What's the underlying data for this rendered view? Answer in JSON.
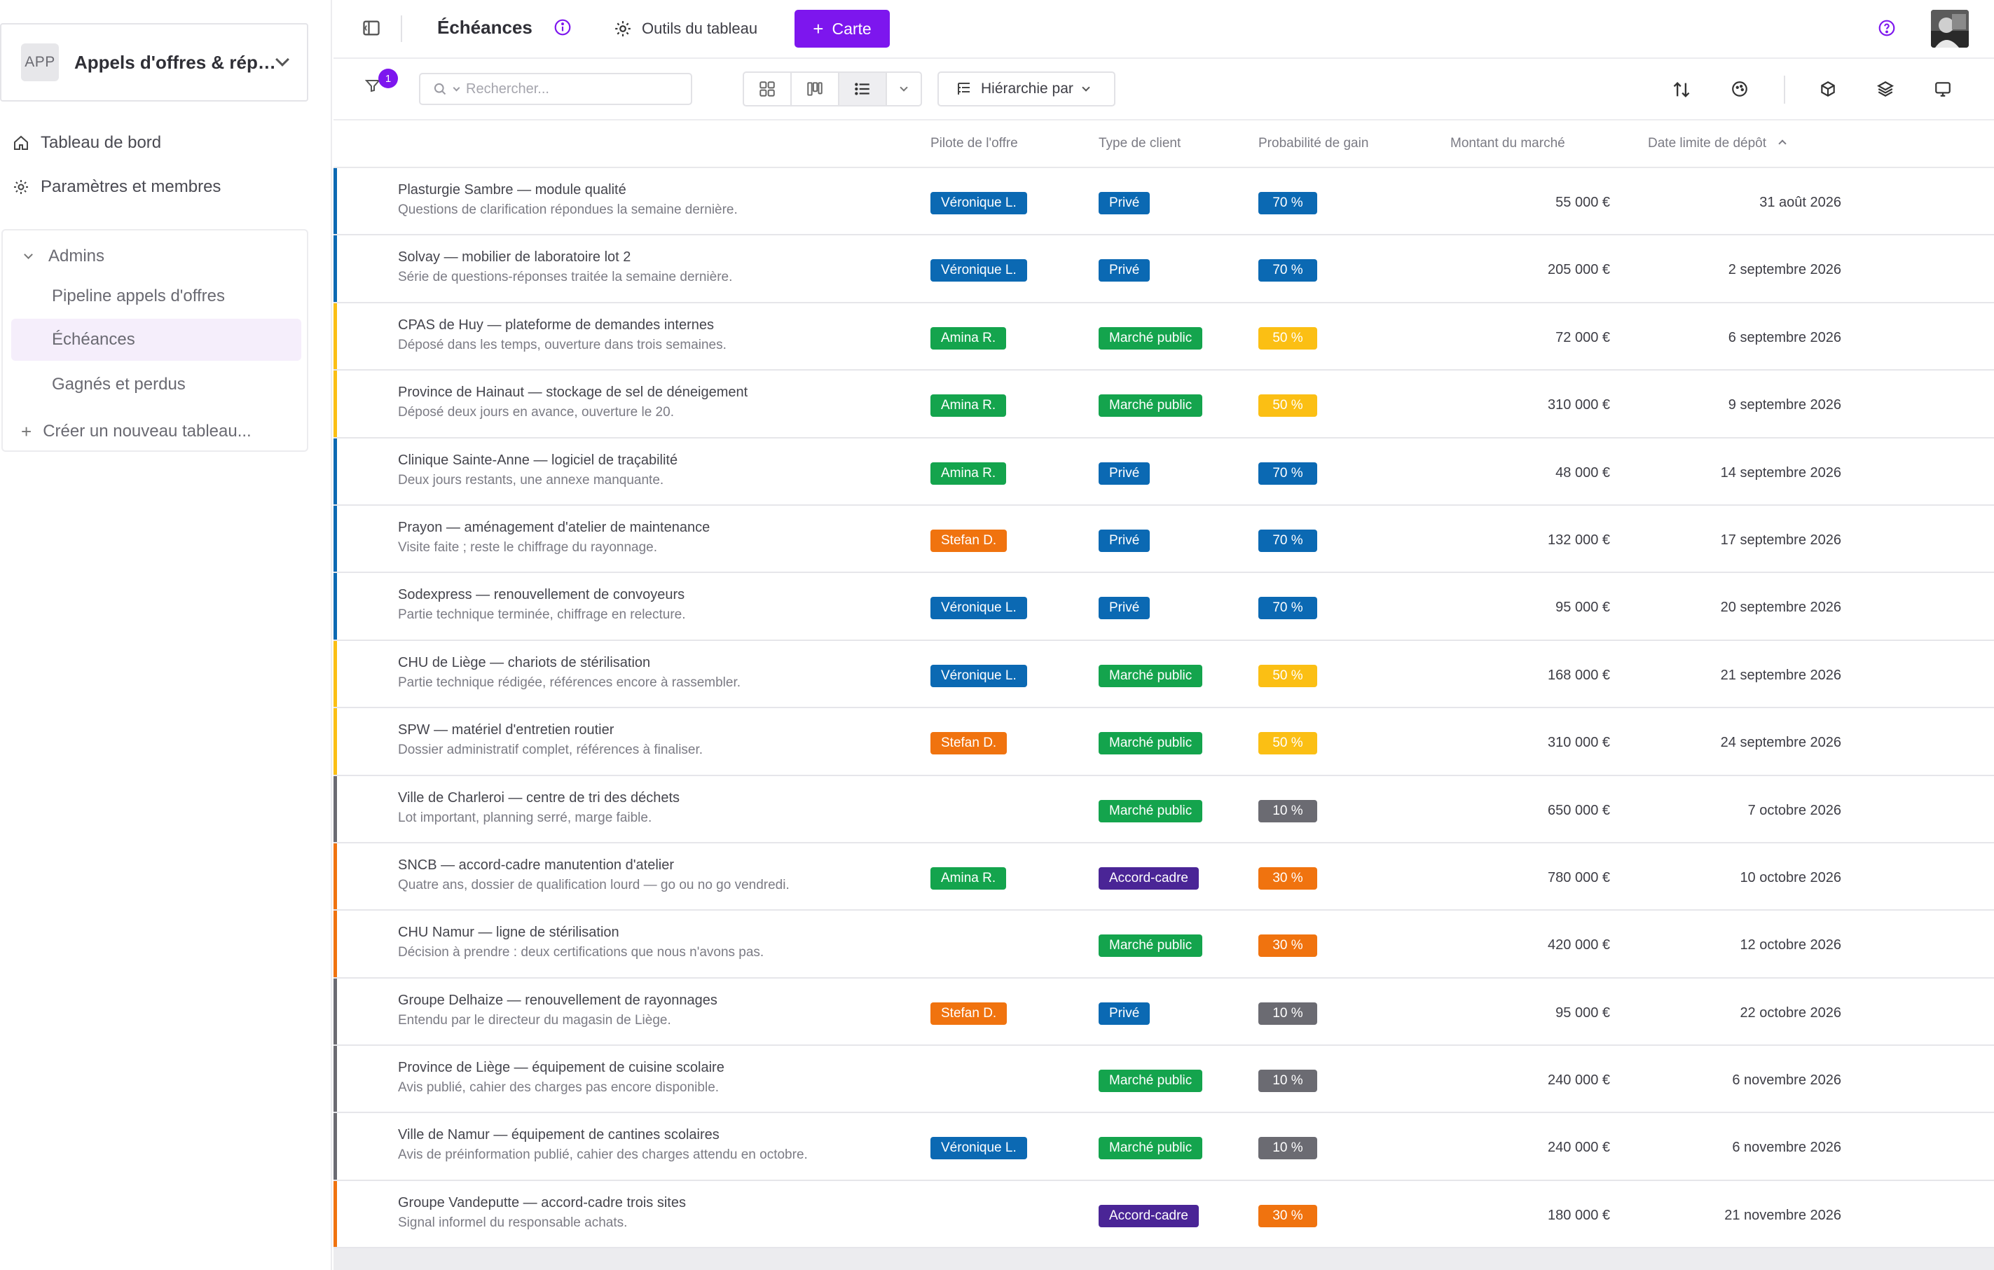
{
  "sidebar": {
    "workspace_badge": "APP",
    "workspace_name": "Appels d'offres & rép…",
    "dashboard_label": "Tableau de bord",
    "settings_label": "Paramètres et membres",
    "group_label": "Admins",
    "boards": [
      {
        "label": "Pipeline appels d'offres",
        "active": false
      },
      {
        "label": "Échéances",
        "active": true
      },
      {
        "label": "Gagnés et perdus",
        "active": false
      }
    ],
    "create_board_label": "Créer un nouveau tableau..."
  },
  "topbar": {
    "title": "Échéances",
    "tools_label": "Outils du tableau",
    "add_card_label": "Carte"
  },
  "toolbar": {
    "filter_count": "1",
    "search_placeholder": "Rechercher...",
    "hierarchy_label": "Hiérarchie par"
  },
  "columns": {
    "pilot": "Pilote de l'offre",
    "client": "Type de client",
    "probability": "Probabilité de gain",
    "amount": "Montant du marché",
    "deadline": "Date limite de dépôt"
  },
  "colors": {
    "accent": "#7d16ee",
    "pilot": {
      "Véronique L.": "#0b69b3",
      "Amina R.": "#14a44d",
      "Stefan D.": "#f0730f"
    },
    "client": {
      "Privé": "#0b69b3",
      "Marché public": "#14a44d",
      "Accord-cadre": "#4a2596"
    },
    "prob": {
      "70 %": "#0b69b3",
      "50 %": "#fbbf14",
      "30 %": "#f0730f",
      "10 %": "#6b6b72"
    }
  },
  "rows": [
    {
      "title": "Plasturgie Sambre — module qualité",
      "subtitle": "Questions de clarification répondues la semaine dernière.",
      "pilot": "Véronique L.",
      "client": "Privé",
      "prob": "70 %",
      "amount": "55 000 €",
      "deadline": "31 août 2026"
    },
    {
      "title": "Solvay — mobilier de laboratoire lot 2",
      "subtitle": "Série de questions-réponses traitée la semaine dernière.",
      "pilot": "Véronique L.",
      "client": "Privé",
      "prob": "70 %",
      "amount": "205 000 €",
      "deadline": "2 septembre 2026"
    },
    {
      "title": "CPAS de Huy — plateforme de demandes internes",
      "subtitle": "Déposé dans les temps, ouverture dans trois semaines.",
      "pilot": "Amina R.",
      "client": "Marché public",
      "prob": "50 %",
      "amount": "72 000 €",
      "deadline": "6 septembre 2026"
    },
    {
      "title": "Province de Hainaut — stockage de sel de déneigement",
      "subtitle": "Déposé deux jours en avance, ouverture le 20.",
      "pilot": "Amina R.",
      "client": "Marché public",
      "prob": "50 %",
      "amount": "310 000 €",
      "deadline": "9 septembre 2026"
    },
    {
      "title": "Clinique Sainte-Anne — logiciel de traçabilité",
      "subtitle": "Deux jours restants, une annexe manquante.",
      "pilot": "Amina R.",
      "client": "Privé",
      "prob": "70 %",
      "amount": "48 000 €",
      "deadline": "14 septembre 2026"
    },
    {
      "title": "Prayon — aménagement d'atelier de maintenance",
      "subtitle": "Visite faite ; reste le chiffrage du rayonnage.",
      "pilot": "Stefan D.",
      "client": "Privé",
      "prob": "70 %",
      "amount": "132 000 €",
      "deadline": "17 septembre 2026"
    },
    {
      "title": "Sodexpress — renouvellement de convoyeurs",
      "subtitle": "Partie technique terminée, chiffrage en relecture.",
      "pilot": "Véronique L.",
      "client": "Privé",
      "prob": "70 %",
      "amount": "95 000 €",
      "deadline": "20 septembre 2026"
    },
    {
      "title": "CHU de Liège — chariots de stérilisation",
      "subtitle": "Partie technique rédigée, références encore à rassembler.",
      "pilot": "Véronique L.",
      "client": "Marché public",
      "prob": "50 %",
      "amount": "168 000 €",
      "deadline": "21 septembre 2026"
    },
    {
      "title": "SPW — matériel d'entretien routier",
      "subtitle": "Dossier administratif complet, références à finaliser.",
      "pilot": "Stefan D.",
      "client": "Marché public",
      "prob": "50 %",
      "amount": "310 000 €",
      "deadline": "24 septembre 2026"
    },
    {
      "title": "Ville de Charleroi — centre de tri des déchets",
      "subtitle": "Lot important, planning serré, marge faible.",
      "pilot": "",
      "client": "Marché public",
      "prob": "10 %",
      "amount": "650 000 €",
      "deadline": "7 octobre 2026"
    },
    {
      "title": "SNCB — accord-cadre manutention d'atelier",
      "subtitle": "Quatre ans, dossier de qualification lourd — go ou no go vendredi.",
      "pilot": "Amina R.",
      "client": "Accord-cadre",
      "prob": "30 %",
      "amount": "780 000 €",
      "deadline": "10 octobre 2026"
    },
    {
      "title": "CHU Namur — ligne de stérilisation",
      "subtitle": "Décision à prendre : deux certifications que nous n'avons pas.",
      "pilot": "",
      "client": "Marché public",
      "prob": "30 %",
      "amount": "420 000 €",
      "deadline": "12 octobre 2026"
    },
    {
      "title": "Groupe Delhaize — renouvellement de rayonnages",
      "subtitle": "Entendu par le directeur du magasin de Liège.",
      "pilot": "Stefan D.",
      "client": "Privé",
      "prob": "10 %",
      "amount": "95 000 €",
      "deadline": "22 octobre 2026"
    },
    {
      "title": "Province de Liège — équipement de cuisine scolaire",
      "subtitle": "Avis publié, cahier des charges pas encore disponible.",
      "pilot": "",
      "client": "Marché public",
      "prob": "10 %",
      "amount": "240 000 €",
      "deadline": "6 novembre 2026"
    },
    {
      "title": "Ville de Namur — équipement de cantines scolaires",
      "subtitle": "Avis de préinformation publié, cahier des charges attendu en octobre.",
      "pilot": "Véronique L.",
      "client": "Marché public",
      "prob": "10 %",
      "amount": "240 000 €",
      "deadline": "6 novembre 2026"
    },
    {
      "title": "Groupe Vandeputte — accord-cadre trois sites",
      "subtitle": "Signal informel du responsable achats.",
      "pilot": "",
      "client": "Accord-cadre",
      "prob": "30 %",
      "amount": "180 000 €",
      "deadline": "21 novembre 2026"
    }
  ]
}
